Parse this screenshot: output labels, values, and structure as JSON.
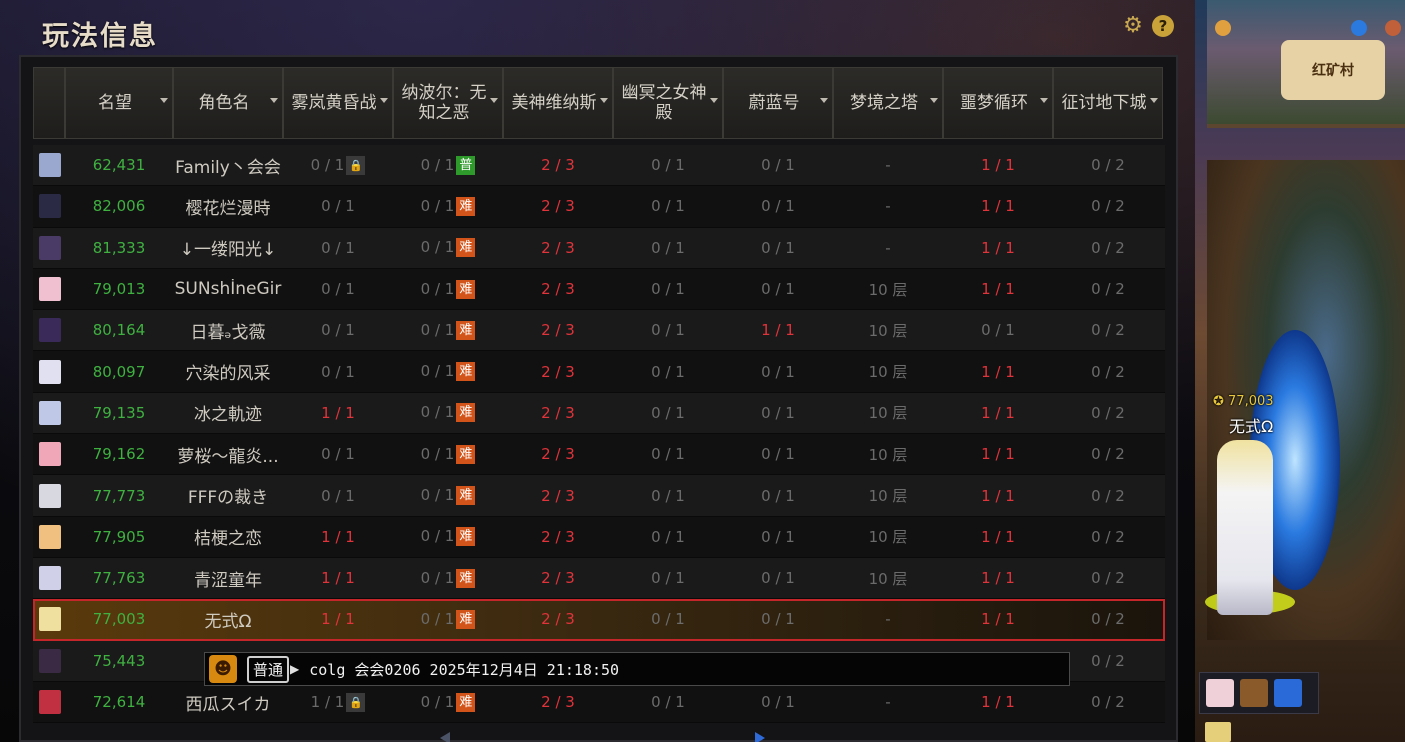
{
  "panel": {
    "title": "玩法信息",
    "settings_icon": "gear-icon",
    "help_icon": "question-icon",
    "help_label": "?"
  },
  "columns": [
    "名望",
    "角色名",
    "雾岚黄昏战",
    "纳波尔：无知之恶",
    "美神维纳斯",
    "幽冥之女神殿",
    "蔚蓝号",
    "梦境之塔",
    "噩梦循环",
    "征讨地下城"
  ],
  "tags": {
    "hard": "难",
    "normal": "普",
    "lock": "🔒"
  },
  "rows": [
    {
      "fame": "62,431",
      "name": "Family丶会会",
      "c1": "0 / 1",
      "c1_red": false,
      "c1_lock": true,
      "c2": "0 / 1",
      "c2_tag": "normal",
      "c3": "2 / 3",
      "c4": "0 / 1",
      "c5": "0 / 1",
      "c5_red": false,
      "c6": "-",
      "c7": "1 / 1",
      "c7_red": true,
      "c8": "0 / 2",
      "avatar": "#9aa8d0"
    },
    {
      "fame": "82,006",
      "name": "樱花烂漫時",
      "c1": "0 / 1",
      "c1_red": false,
      "c2": "0 / 1",
      "c2_tag": "hard",
      "c3": "2 / 3",
      "c4": "0 / 1",
      "c5": "0 / 1",
      "c5_red": false,
      "c6": "-",
      "c7": "1 / 1",
      "c7_red": true,
      "c8": "0 / 2",
      "avatar": "#2a2a44"
    },
    {
      "fame": "81,333",
      "name": "↓一缕阳光↓",
      "c1": "0 / 1",
      "c1_red": false,
      "c2": "0 / 1",
      "c2_tag": "hard",
      "c3": "2 / 3",
      "c4": "0 / 1",
      "c5": "0 / 1",
      "c5_red": false,
      "c6": "-",
      "c7": "1 / 1",
      "c7_red": true,
      "c8": "0 / 2",
      "avatar": "#4a3a66"
    },
    {
      "fame": "79,013",
      "name": "SUNshİneGir",
      "c1": "0 / 1",
      "c1_red": false,
      "c2": "0 / 1",
      "c2_tag": "hard",
      "c3": "2 / 3",
      "c4": "0 / 1",
      "c5": "0 / 1",
      "c5_red": false,
      "c6": "10 层",
      "c7": "1 / 1",
      "c7_red": true,
      "c8": "0 / 2",
      "avatar": "#f0c0d0"
    },
    {
      "fame": "80,164",
      "name": "日暮ₔ戈薇",
      "c1": "0 / 1",
      "c1_red": false,
      "c2": "0 / 1",
      "c2_tag": "hard",
      "c3": "2 / 3",
      "c4": "0 / 1",
      "c5": "1 / 1",
      "c5_red": true,
      "c6": "10 层",
      "c7": "0 / 1",
      "c7_red": false,
      "c8": "0 / 2",
      "avatar": "#3a2a5a"
    },
    {
      "fame": "80,097",
      "name": "穴染的风采",
      "c1": "0 / 1",
      "c1_red": false,
      "c2": "0 / 1",
      "c2_tag": "hard",
      "c3": "2 / 3",
      "c4": "0 / 1",
      "c5": "0 / 1",
      "c5_red": false,
      "c6": "10 层",
      "c7": "1 / 1",
      "c7_red": true,
      "c8": "0 / 2",
      "avatar": "#e0e0f0"
    },
    {
      "fame": "79,135",
      "name": "冰之軌迹",
      "c1": "1 / 1",
      "c1_red": true,
      "c2": "0 / 1",
      "c2_tag": "hard",
      "c3": "2 / 3",
      "c4": "0 / 1",
      "c5": "0 / 1",
      "c5_red": false,
      "c6": "10 层",
      "c7": "1 / 1",
      "c7_red": true,
      "c8": "0 / 2",
      "avatar": "#c0c8e8"
    },
    {
      "fame": "79,162",
      "name": "萝桜～龍炎...",
      "c1": "0 / 1",
      "c1_red": false,
      "c2": "0 / 1",
      "c2_tag": "hard",
      "c3": "2 / 3",
      "c4": "0 / 1",
      "c5": "0 / 1",
      "c5_red": false,
      "c6": "10 层",
      "c7": "1 / 1",
      "c7_red": true,
      "c8": "0 / 2",
      "avatar": "#f0a8b8"
    },
    {
      "fame": "77,773",
      "name": "FFFの裁き",
      "c1": "0 / 1",
      "c1_red": false,
      "c2": "0 / 1",
      "c2_tag": "hard",
      "c3": "2 / 3",
      "c4": "0 / 1",
      "c5": "0 / 1",
      "c5_red": false,
      "c6": "10 层",
      "c7": "1 / 1",
      "c7_red": true,
      "c8": "0 / 2",
      "avatar": "#d8d8e0"
    },
    {
      "fame": "77,905",
      "name": "桔梗之恋",
      "c1": "1 / 1",
      "c1_red": true,
      "c2": "0 / 1",
      "c2_tag": "hard",
      "c3": "2 / 3",
      "c4": "0 / 1",
      "c5": "0 / 1",
      "c5_red": false,
      "c6": "10 层",
      "c7": "1 / 1",
      "c7_red": true,
      "c8": "0 / 2",
      "avatar": "#f0c080"
    },
    {
      "fame": "77,763",
      "name": "青涩童年",
      "c1": "1 / 1",
      "c1_red": true,
      "c2": "0 / 1",
      "c2_tag": "hard",
      "c3": "2 / 3",
      "c4": "0 / 1",
      "c5": "0 / 1",
      "c5_red": false,
      "c6": "10 层",
      "c7": "1 / 1",
      "c7_red": true,
      "c8": "0 / 2",
      "avatar": "#d0d0e8"
    },
    {
      "fame": "77,003",
      "name": "无式Ω",
      "c1": "1 / 1",
      "c1_red": true,
      "c2": "0 / 1",
      "c2_tag": "hard",
      "c3": "2 / 3",
      "c4": "0 / 1",
      "c5": "0 / 1",
      "c5_red": false,
      "c6": "-",
      "c7": "1 / 1",
      "c7_red": true,
      "c8": "0 / 2",
      "selected": true,
      "avatar": "#f0e0a0"
    },
    {
      "fame": "75,443",
      "name": "",
      "c1": "",
      "c1_red": false,
      "c2": "",
      "c2_tag": "",
      "c3": "",
      "c4": "",
      "c5": "",
      "c5_red": false,
      "c6": "",
      "c7": "",
      "c7_red": false,
      "c8": "0 / 2",
      "avatar": "#3a2a44"
    },
    {
      "fame": "72,614",
      "name": "西瓜スイカ",
      "c1": "1 / 1",
      "c1_red": false,
      "c1_lock": true,
      "c2": "0 / 1",
      "c2_tag": "hard",
      "c3": "2 / 3",
      "c4": "0 / 1",
      "c5": "0 / 1",
      "c5_red": false,
      "c6": "-",
      "c7": "1 / 1",
      "c7_red": true,
      "c8": "0 / 2",
      "avatar": "#c03040"
    }
  ],
  "chat": {
    "emoji_icon": "smiley-icon",
    "channel": "普通",
    "text": "colg 会会0206 2025年12月4日 21:18:50"
  },
  "scene": {
    "map_name": "红矿村",
    "player_fame": "77,003",
    "player_name": "无式Ω"
  }
}
